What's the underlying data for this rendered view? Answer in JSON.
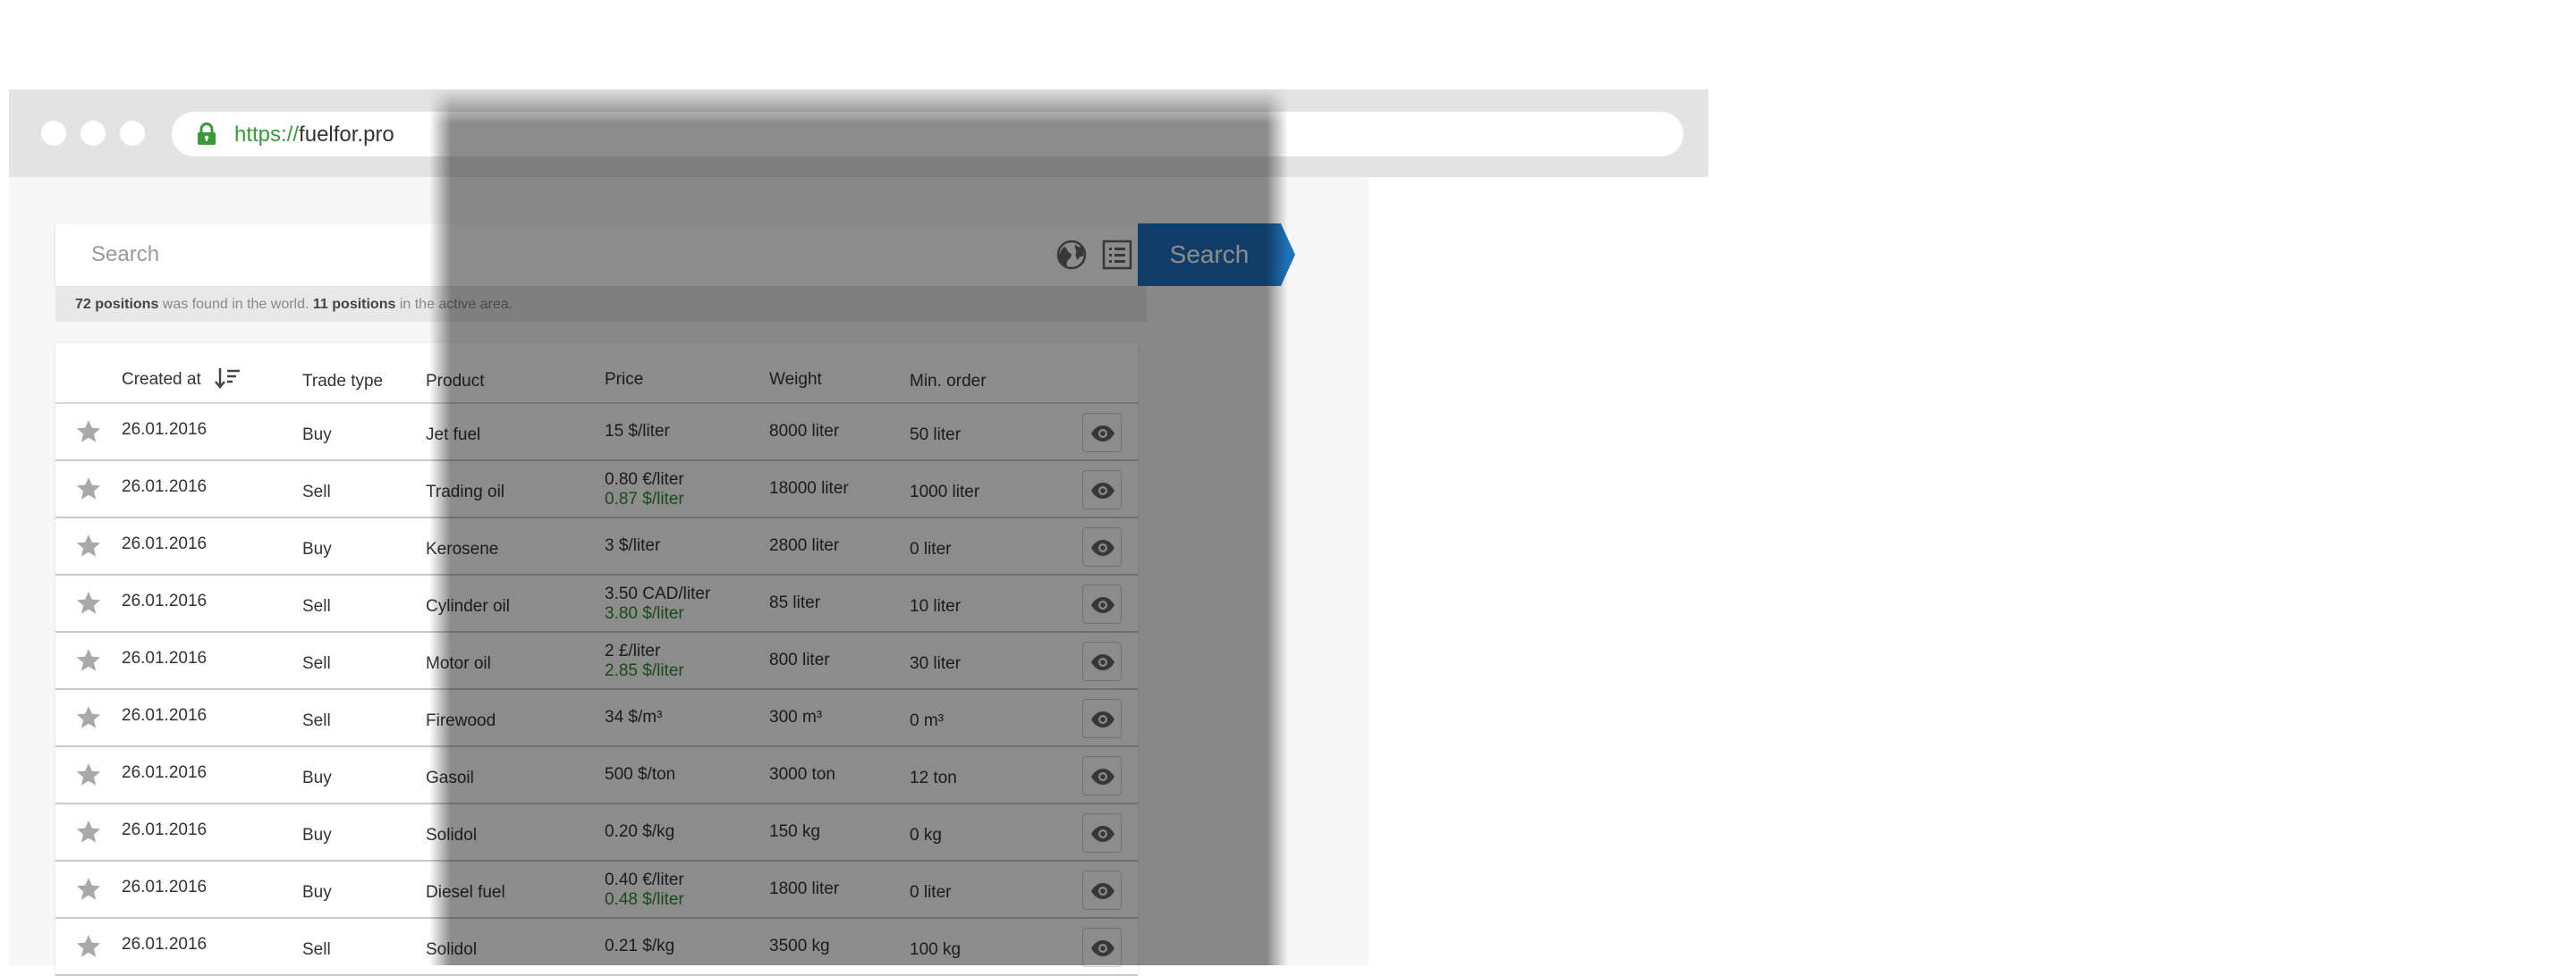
{
  "browser": {
    "url_scheme": "https://",
    "url_host": "fuelfor.pro"
  },
  "search": {
    "placeholder": "Search",
    "button_label": "Search"
  },
  "results_info": {
    "world_count": "72 positions",
    "world_text": " was found in the world. ",
    "area_count": "11 positions",
    "area_text": " in the active area."
  },
  "table": {
    "headers": {
      "created_at": "Created at",
      "trade_type": "Trade type",
      "product": "Product",
      "price": "Price",
      "weight": "Weight",
      "min_order": "Min. order"
    },
    "rows": [
      {
        "created": "26.01.2016",
        "trade": "Buy",
        "product": "Jet fuel",
        "price": "15 $/liter",
        "price_alt": "",
        "weight": "8000 liter",
        "min_order": "50 liter"
      },
      {
        "created": "26.01.2016",
        "trade": "Sell",
        "product": "Trading oil",
        "price": "0.80 €/liter",
        "price_alt": "0.87 $/liter",
        "weight": "18000 liter",
        "min_order": "1000 liter"
      },
      {
        "created": "26.01.2016",
        "trade": "Buy",
        "product": "Kerosene",
        "price": "3 $/liter",
        "price_alt": "",
        "weight": "2800 liter",
        "min_order": "0 liter"
      },
      {
        "created": "26.01.2016",
        "trade": "Sell",
        "product": "Cylinder oil",
        "price": "3.50 CAD/liter",
        "price_alt": "3.80 $/liter",
        "weight": "85 liter",
        "min_order": "10 liter"
      },
      {
        "created": "26.01.2016",
        "trade": "Sell",
        "product": "Motor oil",
        "price": "2 £/liter",
        "price_alt": "2.85 $/liter",
        "weight": "800 liter",
        "min_order": "30 liter"
      },
      {
        "created": "26.01.2016",
        "trade": "Sell",
        "product": "Firewood",
        "price": "34 $/m³",
        "price_alt": "",
        "weight": "300 m³",
        "min_order": "0 m³"
      },
      {
        "created": "26.01.2016",
        "trade": "Buy",
        "product": "Gasoil",
        "price": "500 $/ton",
        "price_alt": "",
        "weight": "3000 ton",
        "min_order": "12 ton"
      },
      {
        "created": "26.01.2016",
        "trade": "Buy",
        "product": "Solidol",
        "price": "0.20 $/kg",
        "price_alt": "",
        "weight": "150 kg",
        "min_order": "0 kg"
      },
      {
        "created": "26.01.2016",
        "trade": "Buy",
        "product": "Diesel fuel",
        "price": "0.40 €/liter",
        "price_alt": "0.48 $/liter",
        "weight": "1800 liter",
        "min_order": "0 liter"
      },
      {
        "created": "26.01.2016",
        "trade": "Sell",
        "product": "Solidol",
        "price": "0.21 $/kg",
        "price_alt": "",
        "weight": "3500 kg",
        "min_order": "100 kg"
      }
    ]
  },
  "icons": {
    "lock": "lock-icon",
    "globe": "globe-icon",
    "list": "list-icon",
    "sort": "sort-descending-icon",
    "star": "star-icon",
    "eye": "eye-icon"
  },
  "colors": {
    "accent": "#1f72bd",
    "green": "#3a9a3a",
    "alt_price": "#2e8b2e"
  }
}
